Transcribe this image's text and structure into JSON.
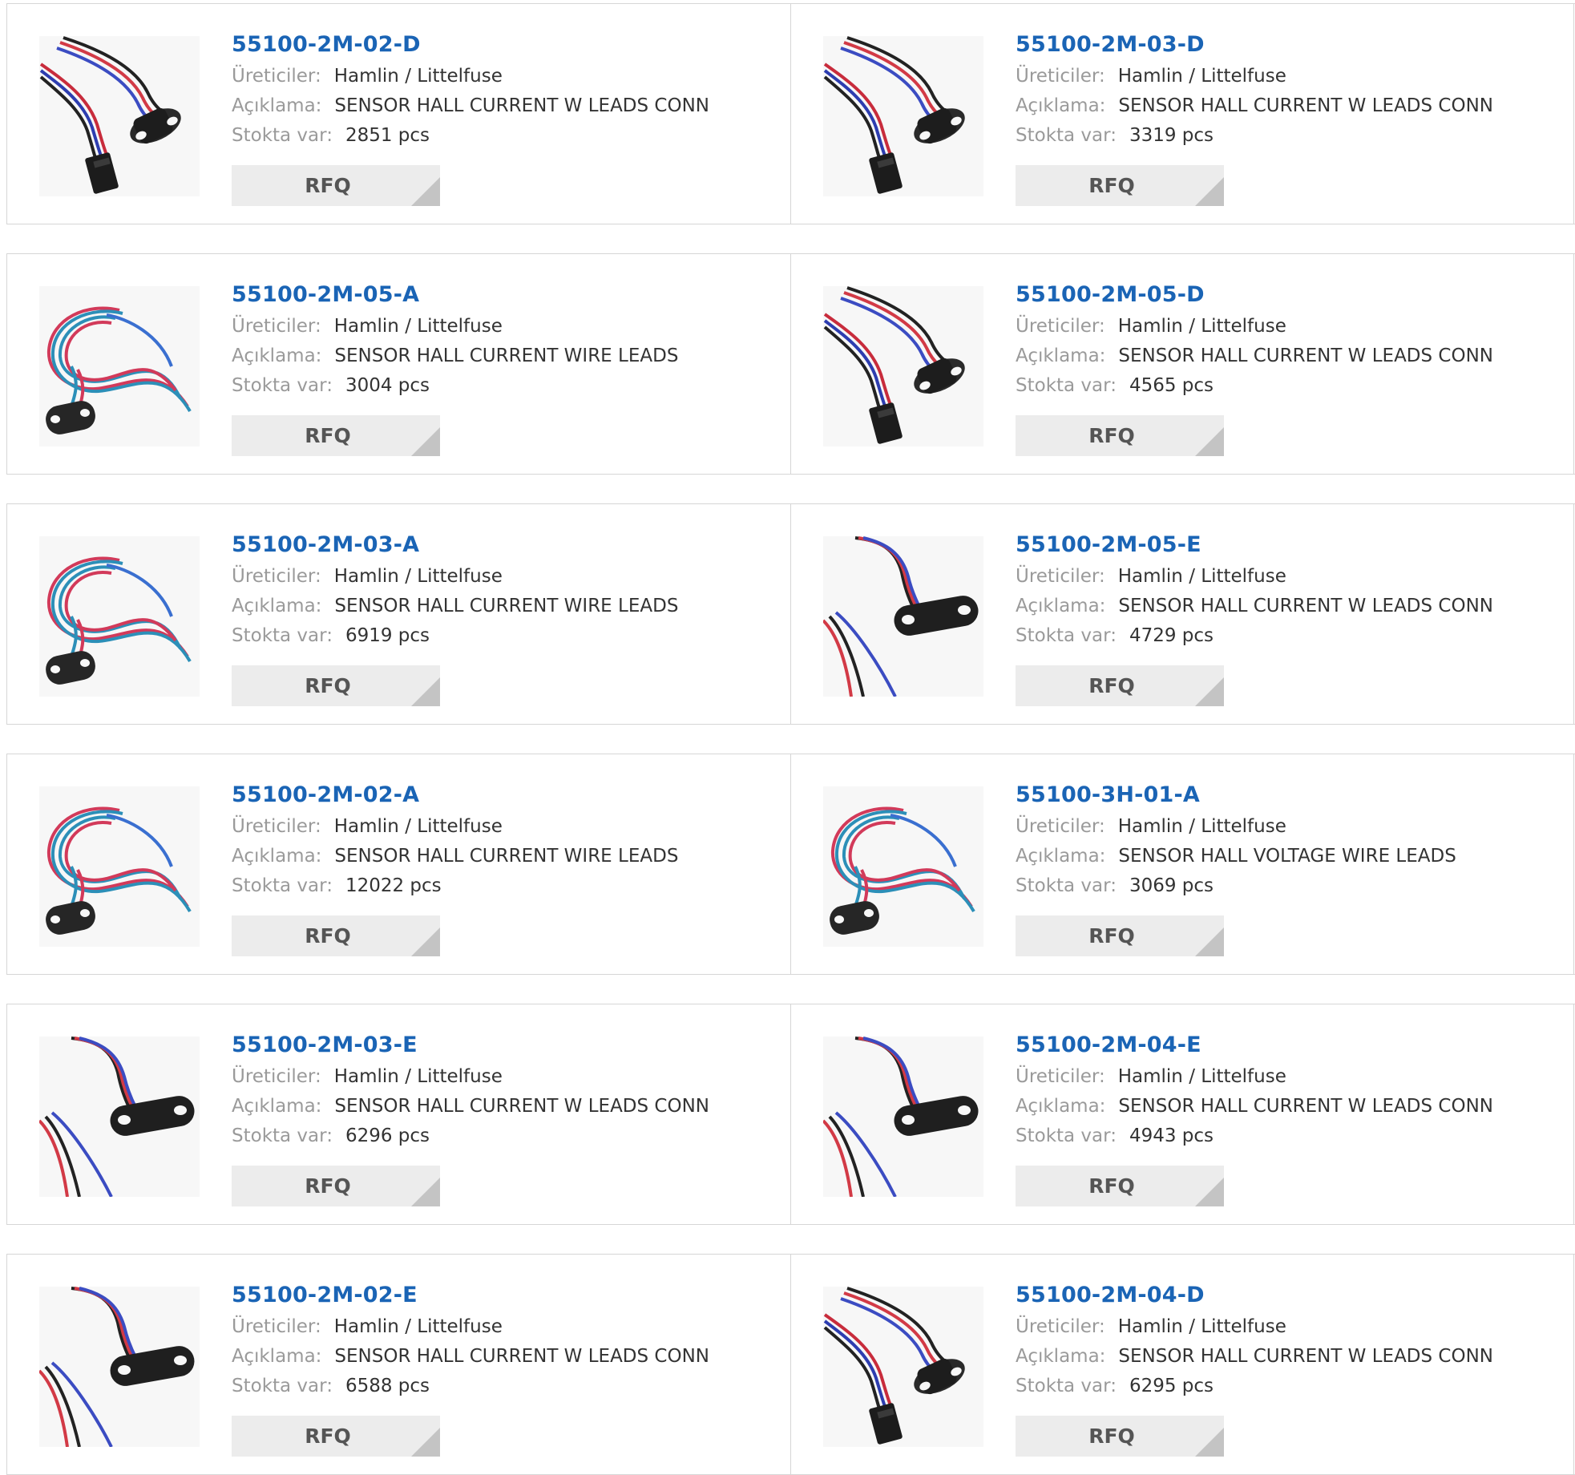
{
  "labels": {
    "manufacturer": "Üreticiler:",
    "description": "Açıklama:",
    "stock": "Stokta var:",
    "rfq": "RFQ"
  },
  "products": [
    {
      "part": "55100-2M-02-D",
      "manufacturer": "Hamlin / Littelfuse",
      "description": "SENSOR HALL CURRENT W LEADS CONN",
      "stock": "2851 pcs",
      "image": "connector-sensor-image"
    },
    {
      "part": "55100-2M-03-D",
      "manufacturer": "Hamlin / Littelfuse",
      "description": "SENSOR HALL CURRENT W LEADS CONN",
      "stock": "3319 pcs",
      "image": "connector-sensor-image"
    },
    {
      "part": "55100-2M-05-A",
      "manufacturer": "Hamlin / Littelfuse",
      "description": "SENSOR HALL CURRENT WIRE LEADS",
      "stock": "3004 pcs",
      "image": "coiled-wire-sensor-image"
    },
    {
      "part": "55100-2M-05-D",
      "manufacturer": "Hamlin / Littelfuse",
      "description": "SENSOR HALL CURRENT W LEADS CONN",
      "stock": "4565 pcs",
      "image": "connector-sensor-image"
    },
    {
      "part": "55100-2M-03-A",
      "manufacturer": "Hamlin / Littelfuse",
      "description": "SENSOR HALL CURRENT WIRE LEADS",
      "stock": "6919 pcs",
      "image": "coiled-wire-sensor-image"
    },
    {
      "part": "55100-2M-05-E",
      "manufacturer": "Hamlin / Littelfuse",
      "description": "SENSOR HALL CURRENT W LEADS CONN",
      "stock": "4729 pcs",
      "image": "open-lead-sensor-image"
    },
    {
      "part": "55100-2M-02-A",
      "manufacturer": "Hamlin / Littelfuse",
      "description": "SENSOR HALL CURRENT WIRE LEADS",
      "stock": "12022 pcs",
      "image": "coiled-wire-sensor-image"
    },
    {
      "part": "55100-3H-01-A",
      "manufacturer": "Hamlin / Littelfuse",
      "description": "SENSOR HALL VOLTAGE WIRE LEADS",
      "stock": "3069 pcs",
      "image": "coiled-wire-sensor-image"
    },
    {
      "part": "55100-2M-03-E",
      "manufacturer": "Hamlin / Littelfuse",
      "description": "SENSOR HALL CURRENT W LEADS CONN",
      "stock": "6296 pcs",
      "image": "open-lead-sensor-image"
    },
    {
      "part": "55100-2M-04-E",
      "manufacturer": "Hamlin / Littelfuse",
      "description": "SENSOR HALL CURRENT W LEADS CONN",
      "stock": "4943 pcs",
      "image": "open-lead-sensor-image"
    },
    {
      "part": "55100-2M-02-E",
      "manufacturer": "Hamlin / Littelfuse",
      "description": "SENSOR HALL CURRENT W LEADS CONN",
      "stock": "6588 pcs",
      "image": "open-lead-sensor-image"
    },
    {
      "part": "55100-2M-04-D",
      "manufacturer": "Hamlin / Littelfuse",
      "description": "SENSOR HALL CURRENT W LEADS CONN",
      "stock": "6295 pcs",
      "image": "connector-sensor-image"
    }
  ],
  "colors": {
    "link": "#1a64b5",
    "label": "#9a9a9a",
    "value": "#333333",
    "border": "#d6d6d6",
    "button_bg": "#ececec",
    "button_text": "#555555"
  }
}
